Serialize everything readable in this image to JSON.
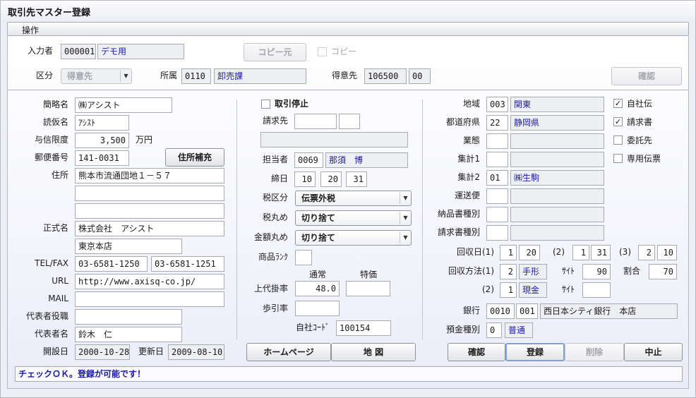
{
  "window": {
    "title": "取引先マスター登録"
  },
  "menu": {
    "operation": "操作"
  },
  "header": {
    "input_user_label": "入力者",
    "input_user_code": "000001",
    "input_user_name": "デモ用",
    "copy_source_button": "コピー元",
    "copy_checkbox_label": "コピー",
    "category_label": "区分",
    "category_value": "得意先",
    "affiliation_label": "所属",
    "affiliation_code": "0110",
    "affiliation_name": "卸売課",
    "customer_label": "得意先",
    "customer_code": "106500",
    "customer_sub": "00",
    "confirm_button": "確認"
  },
  "left": {
    "short_name_label": "簡略名",
    "short_name": "㈱アシスト",
    "kana_label": "読仮名",
    "kana": "ｱｼｽﾄ",
    "credit_label": "与信限度",
    "credit": "3,500",
    "credit_unit": "万円",
    "postal_label": "郵便番号",
    "postal": "141-0031",
    "address_button": "住所補充",
    "address_label": "住所",
    "address1": "熊本市流通団地１－５７",
    "address2": "",
    "address3": "",
    "formal_name_label": "正式名",
    "formal_name": "株式会社　アシスト",
    "branch": "東京本店",
    "telfax_label": "TEL/FAX",
    "tel": "03-6581-1250",
    "fax": "03-6581-1251",
    "url_label": "URL",
    "url": "http://www.axisq-co.jp/",
    "mail_label": "MAIL",
    "mail": "",
    "rep_title_label": "代表者役職",
    "rep_title": "",
    "rep_name_label": "代表者名",
    "rep_name": "鈴木　仁",
    "open_date_label": "開設日",
    "open_date": "2000-10-28",
    "update_date_label": "更新日",
    "update_date": "2009-08-10"
  },
  "middle": {
    "stop_label": "取引停止",
    "billing_label": "請求先",
    "billing_code": "",
    "billing_sub": "",
    "billing_name": "",
    "staff_label": "担当者",
    "staff_code": "0069",
    "staff_name": "那須　博",
    "closing_label": "締日",
    "closing1": "10",
    "closing2": "20",
    "closing3": "31",
    "tax_label": "税区分",
    "tax_value": "伝票外税",
    "tax_round_label": "税丸め",
    "tax_round_value": "切り捨て",
    "amount_round_label": "金額丸め",
    "amount_round_value": "切り捨て",
    "rank_label": "商品ﾗﾝｸ",
    "rank": "",
    "normal_header": "通常",
    "special_header": "特価",
    "price_rate_label": "上代掛率",
    "price_rate_normal": "48.0",
    "price_rate_special": "",
    "bu_rate_label": "歩引率",
    "bu_rate": "",
    "own_code_label": "自社ｺｰﾄﾞ",
    "own_code": "100154",
    "homepage_button": "ホームページ",
    "map_button": "地 図"
  },
  "right": {
    "area_label": "地域",
    "area_code": "003",
    "area_name": "関東",
    "pref_label": "都道府県",
    "pref_code": "22",
    "pref_name": "静岡県",
    "business_label": "業態",
    "business_code": "",
    "business_name": "",
    "agg1_label": "集計1",
    "agg1_code": "",
    "agg1_name": "",
    "agg2_label": "集計2",
    "agg2_code": "01",
    "agg2_name": "㈱生駒",
    "shipping_label": "運送便",
    "shipping_code": "",
    "shipping_name": "",
    "delivery_type_label": "納品書種別",
    "delivery_type_code": "",
    "delivery_type_name": "",
    "invoice_type_label": "請求書種別",
    "invoice_type_code": "",
    "invoice_type_name": "",
    "own_slip_label": "自社伝",
    "invoice_check_label": "請求書",
    "consign_label": "委託先",
    "dedicated_slip_label": "専用伝票",
    "collect_day_label": "回収日(1)",
    "cd1_a": "1",
    "cd1_b": "20",
    "cd2_label": "(2)",
    "cd2_a": "1",
    "cd2_b": "31",
    "cd3_label": "(3)",
    "cd3_a": "2",
    "cd3_b": "10",
    "method1_label": "回収方法(1)",
    "method1_code": "2",
    "method1_name": "手形",
    "site_label": "ｻｲﾄ",
    "site1": "90",
    "ratio_label": "割合",
    "ratio": "70",
    "method2_label": "(2)",
    "method2_code": "1",
    "method2_name": "現金",
    "site2": "",
    "bank_label": "銀行",
    "bank_code": "0010",
    "branch_code": "001",
    "bank_name": "西日本シティ銀行　本店",
    "deposit_label": "預金種別",
    "deposit_code": "0",
    "deposit_name": "普通",
    "confirm_button": "確認",
    "register_button": "登録",
    "delete_button": "削除",
    "cancel_button": "中止"
  },
  "status": {
    "message": "チェックＯＫ。登録が可能です！"
  }
}
